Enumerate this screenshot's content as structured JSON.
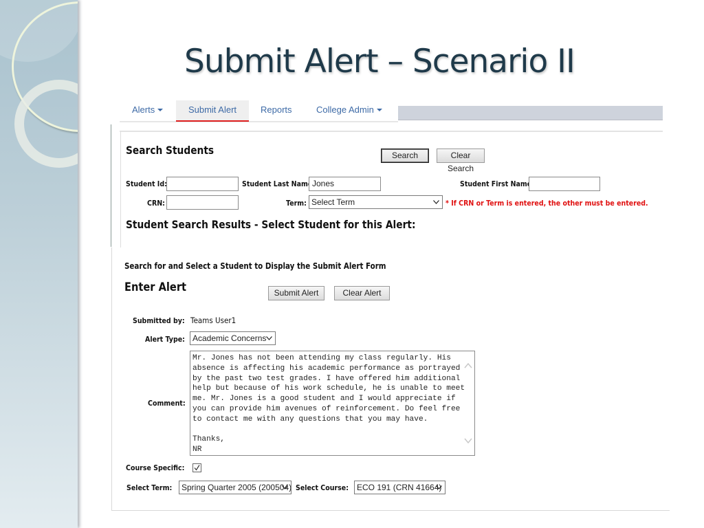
{
  "slide": {
    "title": "Submit Alert – Scenario II"
  },
  "nav": {
    "items": [
      {
        "label": "Alerts",
        "has_dropdown": true,
        "active": false
      },
      {
        "label": "Submit Alert",
        "has_dropdown": false,
        "active": true
      },
      {
        "label": "Reports",
        "has_dropdown": false,
        "active": false
      },
      {
        "label": "College Admin",
        "has_dropdown": true,
        "active": false
      }
    ],
    "active_color": "#e02020",
    "link_color": "#3d6aa6"
  },
  "search": {
    "heading": "Search Students",
    "search_button": "Search",
    "clear_button": "Clear Search",
    "student_id_label": "Student Id:",
    "student_id_value": "",
    "last_name_label": "Student Last Name:",
    "last_name_value": "Jones",
    "first_name_label": "Student First Name:",
    "first_name_value": "",
    "crn_label": "CRN:",
    "crn_value": "",
    "term_label": "Term:",
    "term_value": "Select Term",
    "note": "* If CRN or Term is entered, the other must be entered.",
    "note_color": "#e01010",
    "results_heading": "Student Search Results - Select Student for this Alert:"
  },
  "alert": {
    "instruction": "Search for and Select a Student to Display the Submit Alert Form",
    "heading": "Enter Alert",
    "submit_button": "Submit Alert",
    "clear_button": "Clear Alert",
    "submitted_by_label": "Submitted by:",
    "submitted_by_value": "Teams User1",
    "alert_type_label": "Alert Type:",
    "alert_type_value": "Academic Concerns",
    "comment_label": "Comment:",
    "comment_value": "Mr. Jones has not been attending my class regularly. His\nabsence is affecting his academic performance as portrayed\nby the past two test grades. I have offered him additional\nhelp but because of his work schedule, he is unable to meet\nme. Mr. Jones is a good student and I would appreciate if\nyou can provide him avenues of reinforcement. Do feel free\nto contact me with any questions that you may have.\n\nThanks,\nNR",
    "course_specific_label": "Course Specific:",
    "course_specific_checked": true,
    "select_term_label": "Select Term:",
    "select_term_value": "Spring Quarter 2005 (200504)",
    "select_course_label": "Select Course:",
    "select_course_value": "ECO 191 (CRN 41664)"
  }
}
